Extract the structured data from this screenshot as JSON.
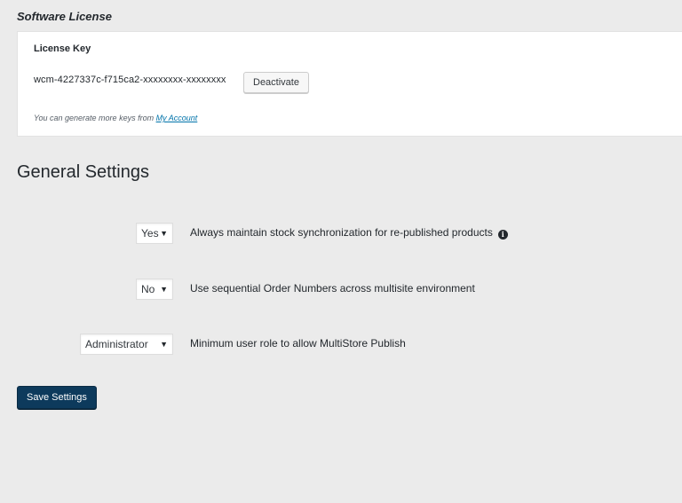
{
  "license": {
    "section_title": "Software License",
    "key_label": "License Key",
    "key_value": "wcm-4227337c-f715ca2-xxxxxxxx-xxxxxxxx",
    "deactivate_label": "Deactivate",
    "note_prefix": "You can generate more keys from ",
    "note_link": "My Account"
  },
  "general": {
    "title": "General Settings",
    "settings": [
      {
        "selected": "Yes",
        "label": "Always maintain stock synchronization for re-published products",
        "has_info_icon": true
      },
      {
        "selected": "No",
        "label": "Use sequential Order Numbers across multisite environment"
      },
      {
        "selected": "Administrator",
        "label": "Minimum user role to allow MultiStore Publish"
      }
    ],
    "save_label": "Save Settings"
  },
  "icons": {
    "dropdown_arrow": "chevron-down-icon",
    "info": "info-icon"
  },
  "colors": {
    "background": "#ebebeb",
    "panel": "#ffffff",
    "link": "#0073aa",
    "primary_button": "#0d3a5c"
  }
}
